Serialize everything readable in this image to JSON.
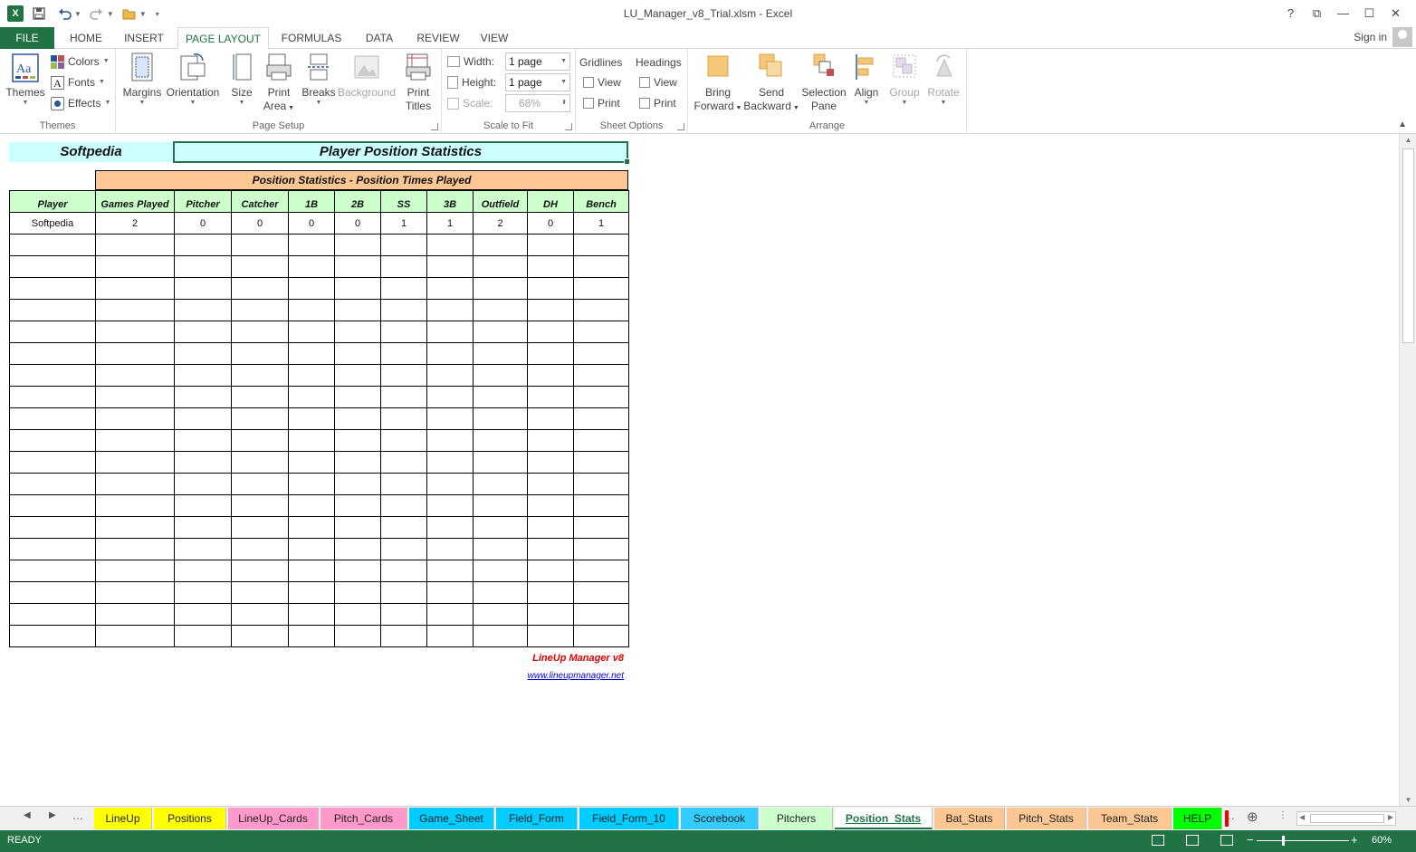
{
  "window": {
    "title": "LU_Manager_v8_Trial.xlsm - Excel",
    "app_icon": "X",
    "controls": [
      "?",
      "⧉",
      "—",
      "☐",
      "✕"
    ]
  },
  "ribbon_tabs": [
    "FILE",
    "HOME",
    "INSERT",
    "PAGE LAYOUT",
    "FORMULAS",
    "DATA",
    "REVIEW",
    "VIEW"
  ],
  "active_ribbon_tab": "PAGE LAYOUT",
  "signin": "Sign in",
  "ribbon": {
    "themes": {
      "label": "Themes",
      "btn": "Themes",
      "colors": "Colors",
      "fonts": "Fonts",
      "effects": "Effects"
    },
    "page_setup": {
      "label": "Page Setup",
      "margins": "Margins",
      "orientation": "Orientation",
      "size": "Size",
      "print_area_1": "Print",
      "print_area_2": "Area",
      "breaks": "Breaks",
      "background": "Background",
      "print_titles_1": "Print",
      "print_titles_2": "Titles"
    },
    "scale": {
      "label": "Scale to Fit",
      "width_label": "Width:",
      "width_value": "1 page",
      "height_label": "Height:",
      "height_value": "1 page",
      "scale_label": "Scale:",
      "scale_value": "68%"
    },
    "sheet_options": {
      "label": "Sheet Options",
      "gridlines": "Gridlines",
      "headings": "Headings",
      "view": "View",
      "print": "Print"
    },
    "arrange": {
      "label": "Arrange",
      "bring_1": "Bring",
      "bring_2": "Forward",
      "send_1": "Send",
      "send_2": "Backward",
      "sel_1": "Selection",
      "sel_2": "Pane",
      "align": "Align",
      "group": "Group",
      "rotate": "Rotate"
    }
  },
  "sheet": {
    "softpedia_label": "Softpedia",
    "title": "Player Position Statistics",
    "subtitle": "Position Statistics - Position Times Played",
    "headers": [
      "Player",
      "Games Played",
      "Pitcher",
      "Catcher",
      "1B",
      "2B",
      "SS",
      "3B",
      "Outfield",
      "DH",
      "Bench"
    ],
    "rows": [
      [
        "Softpedia",
        "2",
        "0",
        "0",
        "0",
        "0",
        "1",
        "1",
        "2",
        "0",
        "1"
      ]
    ],
    "brand": "LineUp Manager v8",
    "brand_link": "www.lineupmanager.net"
  },
  "sheet_tabs": [
    {
      "name": "LineUp",
      "color": "#ffff00"
    },
    {
      "name": "Positions",
      "color": "#ffff00"
    },
    {
      "name": "LineUp_Cards",
      "color": "#ff99cc"
    },
    {
      "name": "Pitch_Cards",
      "color": "#ff99cc"
    },
    {
      "name": "Game_Sheet",
      "color": "#00ccff"
    },
    {
      "name": "Field_Form",
      "color": "#00ccff"
    },
    {
      "name": "Field_Form_10",
      "color": "#00ccff"
    },
    {
      "name": "Scorebook",
      "color": "#33ccff"
    },
    {
      "name": "Pitchers",
      "color": "#ccffcc"
    },
    {
      "name": "Position_Stats",
      "color": "#ffffff"
    },
    {
      "name": "Bat_Stats",
      "color": "#fcc792"
    },
    {
      "name": "Pitch_Stats",
      "color": "#fcc792"
    },
    {
      "name": "Team_Stats",
      "color": "#fcc792"
    },
    {
      "name": "HELP",
      "color": "#00ff00"
    }
  ],
  "active_sheet_tab": "Position_Stats",
  "status": {
    "text": "READY",
    "zoom": "60%"
  }
}
